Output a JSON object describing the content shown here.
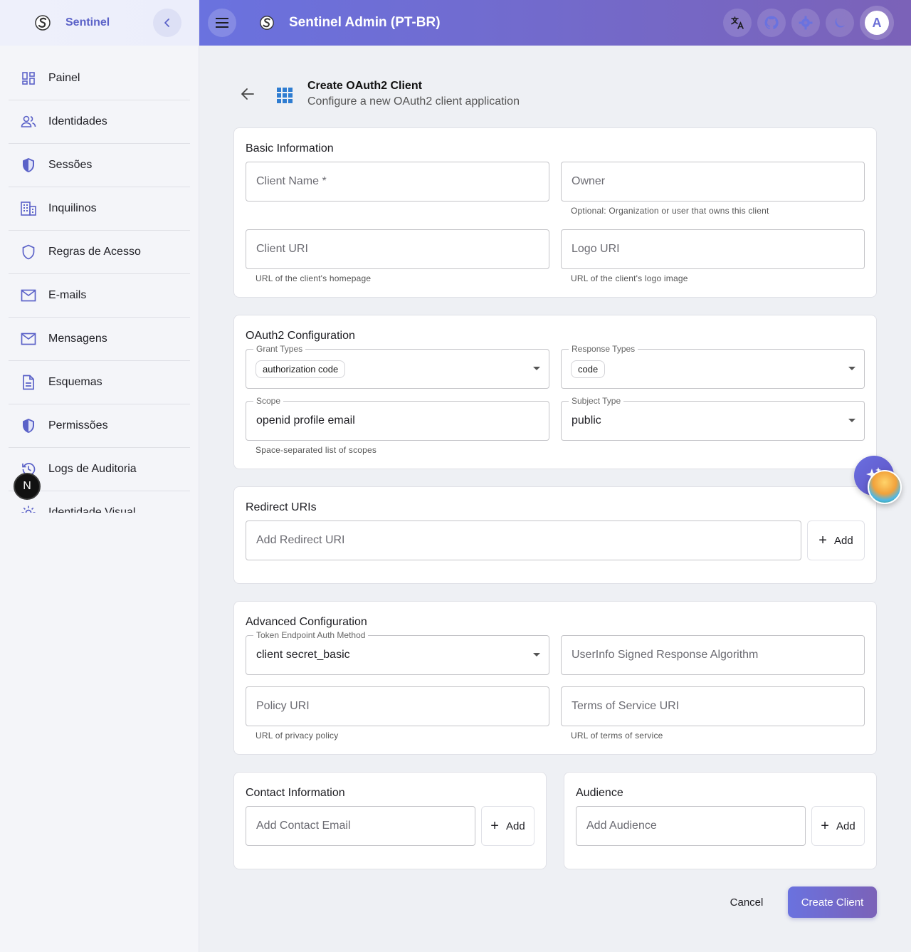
{
  "app": {
    "brand": "Sentinel",
    "title": "Sentinel Admin (PT-BR)",
    "avatar_initial": "A",
    "accent": "#6a72df",
    "next_badge": "N"
  },
  "sidebar": {
    "items": [
      {
        "label": "Painel",
        "icon": "dashboard-icon"
      },
      {
        "label": "Identidades",
        "icon": "users-icon"
      },
      {
        "label": "Sessões",
        "icon": "shield-half-icon"
      },
      {
        "label": "Inquilinos",
        "icon": "building-icon"
      },
      {
        "label": "Regras de Acesso",
        "icon": "shield-outline-icon"
      },
      {
        "label": "E-mails",
        "icon": "mail-icon"
      },
      {
        "label": "Mensagens",
        "icon": "mail-icon"
      },
      {
        "label": "Esquemas",
        "icon": "document-icon"
      },
      {
        "label": "Permissões",
        "icon": "shield-half-icon"
      },
      {
        "label": "Logs de Auditoria",
        "icon": "history-icon"
      },
      {
        "label": "Identidade Visual",
        "icon": "gear-icon"
      }
    ]
  },
  "page": {
    "title": "Create OAuth2 Client",
    "subtitle": "Configure a new OAuth2 client application"
  },
  "basic": {
    "title": "Basic Information",
    "client_name_placeholder": "Client Name *",
    "owner_placeholder": "Owner",
    "owner_helper": "Optional: Organization or user that owns this client",
    "client_uri_placeholder": "Client URI",
    "client_uri_helper": "URL of the client's homepage",
    "logo_uri_placeholder": "Logo URI",
    "logo_uri_helper": "URL of the client's logo image"
  },
  "oauth": {
    "title": "OAuth2 Configuration",
    "grant_types_label": "Grant Types",
    "grant_types_value": "authorization code",
    "response_types_label": "Response Types",
    "response_types_value": "code",
    "scope_label": "Scope",
    "scope_value": "openid profile email",
    "scope_helper": "Space-separated list of scopes",
    "subject_type_label": "Subject Type",
    "subject_type_value": "public"
  },
  "redirect": {
    "title": "Redirect URIs",
    "placeholder": "Add Redirect URI",
    "add_label": "Add"
  },
  "advanced": {
    "title": "Advanced Configuration",
    "token_auth_label": "Token Endpoint Auth Method",
    "token_auth_value": "client secret_basic",
    "userinfo_placeholder": "UserInfo Signed Response Algorithm",
    "policy_placeholder": "Policy URI",
    "policy_helper": "URL of privacy policy",
    "tos_placeholder": "Terms of Service URI",
    "tos_helper": "URL of terms of service"
  },
  "contact": {
    "title": "Contact Information",
    "placeholder": "Add Contact Email",
    "add_label": "Add"
  },
  "audience": {
    "title": "Audience",
    "placeholder": "Add Audience",
    "add_label": "Add"
  },
  "actions": {
    "cancel": "Cancel",
    "create": "Create Client"
  }
}
